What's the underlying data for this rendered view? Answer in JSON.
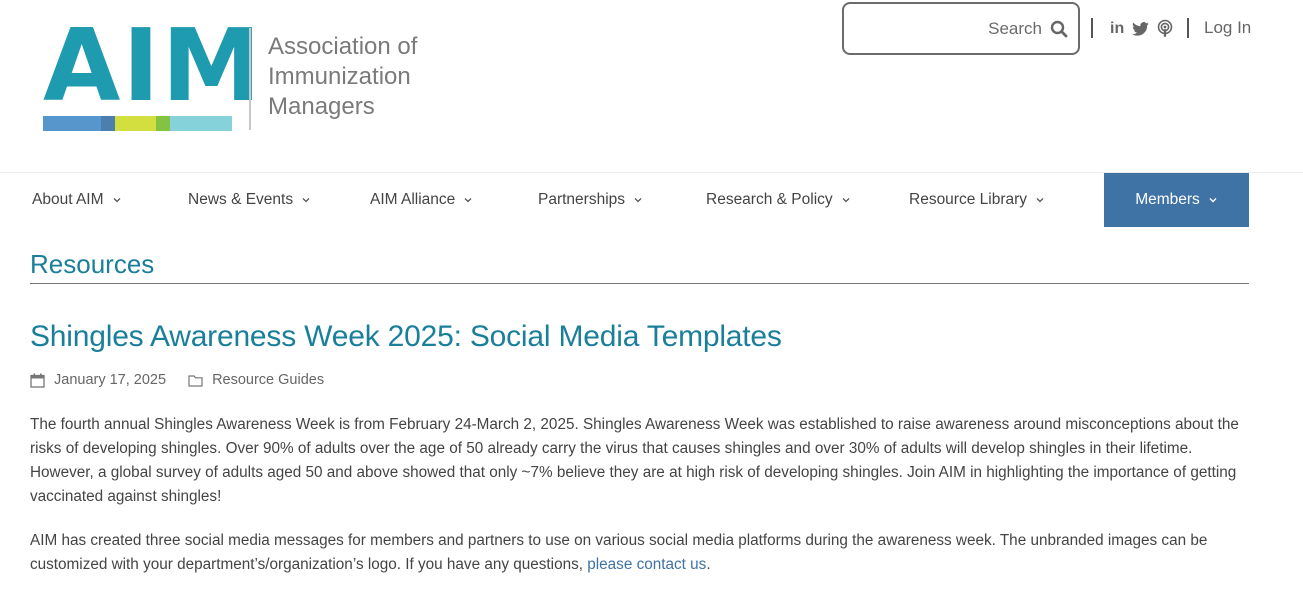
{
  "brand": {
    "logo_letters": "AIM",
    "name_lines": [
      "Association of",
      "Immunization",
      "Managers"
    ],
    "bar_colors": [
      "#5696cd",
      "#4d7fae",
      "#d3df3e",
      "#83c341",
      "#86d2da"
    ],
    "primary_color": "#1f9bb0"
  },
  "header": {
    "search_placeholder": "Search",
    "social_icons": [
      "linkedin-icon",
      "twitter-icon",
      "podcast-icon"
    ],
    "linkedin_label": "in",
    "login_label": "Log In"
  },
  "nav": {
    "items": [
      {
        "label": "About AIM"
      },
      {
        "label": "News & Events"
      },
      {
        "label": "AIM Alliance"
      },
      {
        "label": "Partnerships"
      },
      {
        "label": "Research & Policy"
      },
      {
        "label": "Resource Library"
      },
      {
        "label": "Members"
      }
    ],
    "members_color": "#3f72a5"
  },
  "content": {
    "section_title": "Resources",
    "post_title": "Shingles Awareness Week 2025: Social Media Templates",
    "date": "January 17, 2025",
    "category": "Resource Guides",
    "paragraph1": "The fourth annual Shingles Awareness Week is from February 24-March 2, 2025. Shingles Awareness Week was established to raise awareness around misconceptions about the risks of developing shingles. Over 90% of adults over the age of 50 already carry the virus that causes shingles and over 30% of adults will develop shingles in their lifetime. However, a global survey of adults aged 50 and above showed that only ~7% believe they are at high risk of developing shingles. Join AIM in highlighting the importance of getting vaccinated against shingles!",
    "paragraph2_prefix": "AIM has created three social media messages for members and partners to use on various social media platforms during the awareness week. The unbranded images can be customized with your department’s/organization’s logo. If you have any questions, ",
    "paragraph2_link": "please contact us",
    "paragraph2_suffix": "."
  }
}
